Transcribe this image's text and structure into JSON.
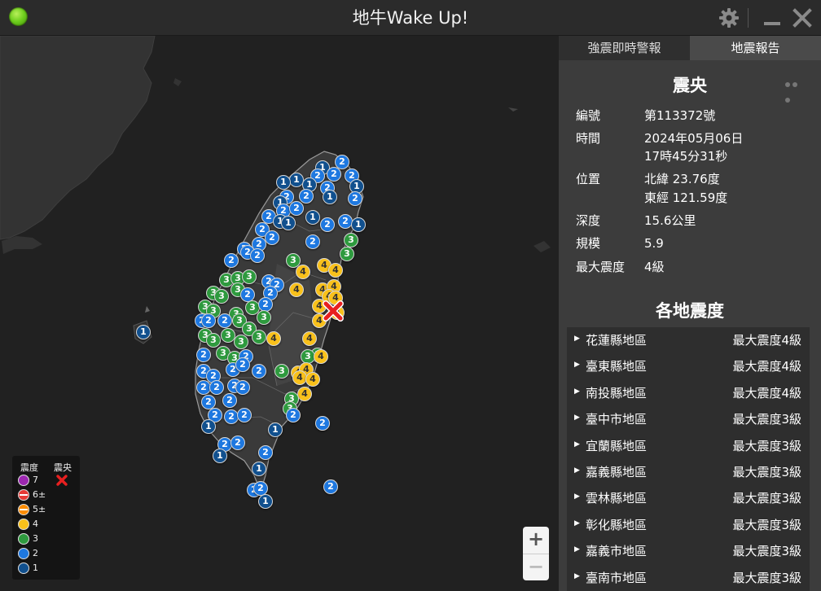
{
  "app": {
    "title": "地牛Wake Up!"
  },
  "tabs": [
    {
      "label": "強震即時警報",
      "active": false
    },
    {
      "label": "地震報告",
      "active": true
    }
  ],
  "report": {
    "section_title": "震央",
    "fields": [
      {
        "label": "編號",
        "value": "第113372號"
      },
      {
        "label": "時間",
        "value": "2024年05月06日",
        "value2": "17時45分31秒"
      },
      {
        "label": "位置",
        "value": "北緯 23.76度",
        "value2": "東經 121.59度"
      },
      {
        "label": "深度",
        "value": "15.6公里"
      },
      {
        "label": "規模",
        "value": "5.9"
      },
      {
        "label": "最大震度",
        "value": "4級"
      }
    ]
  },
  "regions": {
    "section_title": "各地震度",
    "items": [
      {
        "name": "花蓮縣地區",
        "max": "最大震度4級"
      },
      {
        "name": "臺東縣地區",
        "max": "最大震度4級"
      },
      {
        "name": "南投縣地區",
        "max": "最大震度4級"
      },
      {
        "name": "臺中市地區",
        "max": "最大震度3級"
      },
      {
        "name": "宜蘭縣地區",
        "max": "最大震度3級"
      },
      {
        "name": "嘉義縣地區",
        "max": "最大震度3級"
      },
      {
        "name": "雲林縣地區",
        "max": "最大震度3級"
      },
      {
        "name": "彰化縣地區",
        "max": "最大震度3級"
      },
      {
        "name": "嘉義市地區",
        "max": "最大震度3級"
      },
      {
        "name": "臺南市地區",
        "max": "最大震度3級"
      }
    ]
  },
  "legend": {
    "intensity_header": "震度",
    "epicenter_header": "震央",
    "levels": [
      {
        "label": "7",
        "color": "#9c27b0",
        "split": false
      },
      {
        "label": "6±",
        "color": "#e53935",
        "split": true
      },
      {
        "label": "5±",
        "color": "#fb8c00",
        "split": true
      },
      {
        "label": "4",
        "color": "#f9c11b",
        "split": false
      },
      {
        "label": "3",
        "color": "#2e9a3e",
        "split": false
      },
      {
        "label": "2",
        "color": "#1e78e0",
        "split": false
      },
      {
        "label": "1",
        "color": "#11508e",
        "split": false
      }
    ]
  },
  "map": {
    "zoom_in": "+",
    "zoom_out": "−",
    "colors": {
      "1": "#11508e",
      "2": "#1e78e0",
      "3": "#2e9a3e",
      "4": "#f9c11b"
    }
  }
}
